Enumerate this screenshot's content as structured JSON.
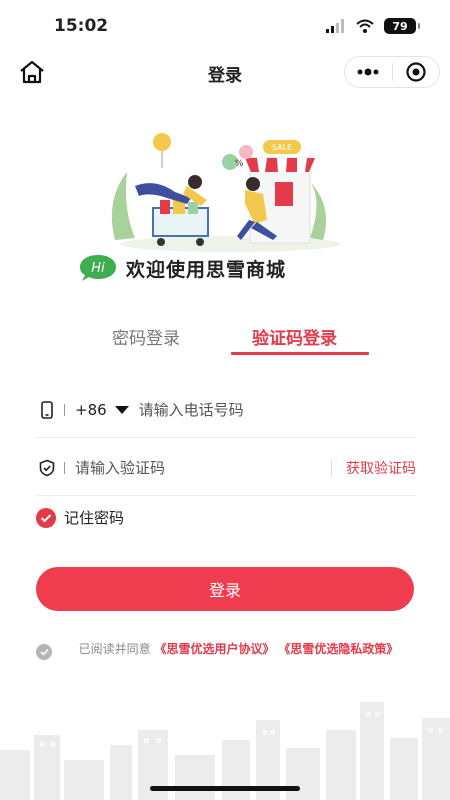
{
  "status_bar": {
    "time": "15:02",
    "battery": "79"
  },
  "nav": {
    "title": "登录"
  },
  "welcome": {
    "hi": "Hi",
    "text": "欢迎使用思雪商城"
  },
  "hero": {
    "sign": "SALE",
    "badge": "%"
  },
  "tabs": {
    "password_login": "密码登录",
    "code_login": "验证码登录"
  },
  "phone": {
    "country_code": "+86",
    "placeholder": "请输入电话号码"
  },
  "code": {
    "placeholder": "请输入验证码",
    "get_code": "获取验证码"
  },
  "remember": {
    "label": "记住密码"
  },
  "login_button": "登录",
  "agreement": {
    "prefix": "已阅读并同意",
    "user_agreement": "《思雪优选用户协议》",
    "privacy_policy": "《思雪优选隐私政策》"
  },
  "colors": {
    "accent": "#e23b4a",
    "button": "#ef3c4e"
  }
}
